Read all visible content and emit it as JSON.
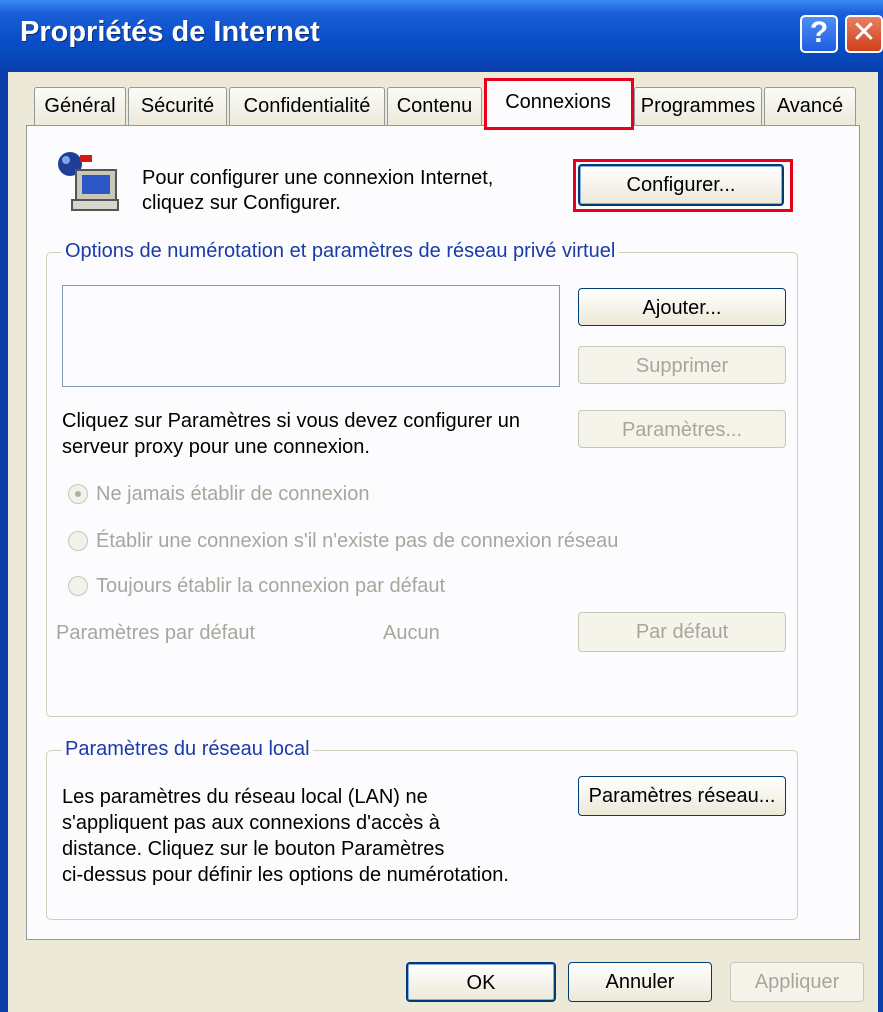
{
  "window": {
    "title": "Propriétés de Internet",
    "help_label": "?",
    "close_label": "✕"
  },
  "tabs": [
    {
      "label": "Général",
      "active": false
    },
    {
      "label": "Sécurité",
      "active": false
    },
    {
      "label": "Confidentialité",
      "active": false
    },
    {
      "label": "Contenu",
      "active": false
    },
    {
      "label": "Connexions",
      "active": true
    },
    {
      "label": "Programmes",
      "active": false
    },
    {
      "label": "Avancé",
      "active": false
    }
  ],
  "setup": {
    "icon": "network-computer-icon",
    "text_line1": "Pour configurer une connexion Internet,",
    "text_line2": "cliquez sur Configurer.",
    "button": "Configurer..."
  },
  "dialup": {
    "legend": "Options de numérotation et paramètres de réseau privé virtuel",
    "add_button": "Ajouter...",
    "remove_button": "Supprimer",
    "proxy_text_line1": "Cliquez sur Paramètres si vous devez configurer un",
    "proxy_text_line2": "serveur proxy pour une connexion.",
    "settings_button": "Paramètres...",
    "radio_never": "Ne jamais établir de connexion",
    "radio_when_no_network": "Établir une connexion s'il n'existe pas de connexion réseau",
    "radio_always": "Toujours établir la connexion par défaut",
    "default_label": "Paramètres par défaut",
    "default_value": "Aucun",
    "default_button": "Par défaut"
  },
  "lan": {
    "legend": "Paramètres du réseau local",
    "text_line1": "Les paramètres du réseau local (LAN) ne",
    "text_line2": "s'appliquent pas aux connexions d'accès à",
    "text_line3": "distance. Cliquez sur le bouton Paramètres",
    "text_line4": "ci-dessus pour définir les options de numérotation.",
    "button": "Paramètres réseau..."
  },
  "footer": {
    "ok": "OK",
    "cancel": "Annuler",
    "apply": "Appliquer"
  },
  "colors": {
    "titlebar": "#0a4fc8",
    "highlight": "#e8001c",
    "dialog_bg": "#ece9d8"
  }
}
